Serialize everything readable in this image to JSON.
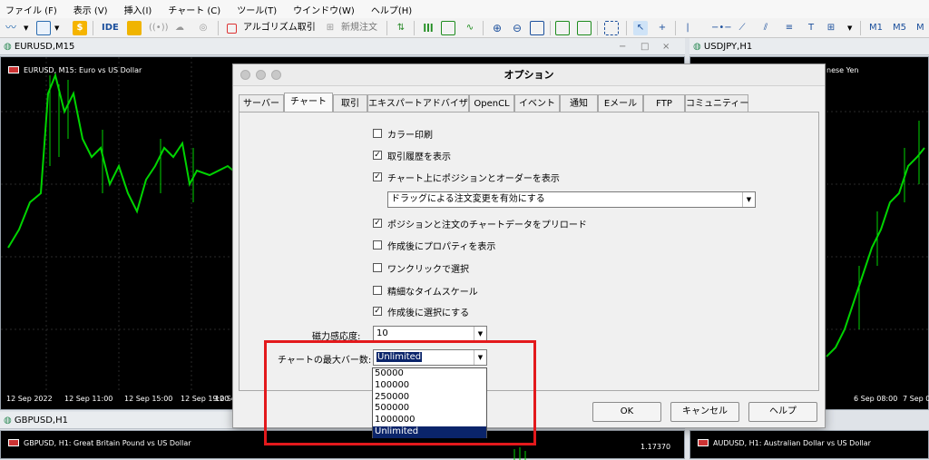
{
  "menu": [
    "ファイル (F)",
    "表示 (V)",
    "挿入(I)",
    "チャート (C)",
    "ツール(T)",
    "ウインドウ(W)",
    "ヘルプ(H)"
  ],
  "toolbar": {
    "ide_label": "IDE",
    "algo_label": "アルゴリズム取引",
    "new_order_label": "新規注文",
    "timeframes": [
      "M1",
      "M5",
      "M"
    ]
  },
  "windows": {
    "eurusd": {
      "title": "EURUSD,M15",
      "subtitle": "EURUSD, M15: Euro vs US Dollar",
      "time_labels": [
        "12 Sep 2022",
        "12 Sep 11:00",
        "12 Sep 15:00",
        "12 Sep 19:00",
        "12 Se"
      ]
    },
    "usdjpy": {
      "title": "USDJPY,H1",
      "subtitle": "nese Yen",
      "time_labels": [
        "6 Sep 08:00",
        "7 Sep 0"
      ]
    },
    "gbpusd": {
      "title": "GBPUSD,H1",
      "subtitle": "GBPUSD, H1: Great Britain Pound vs US Dollar",
      "price": "1.17370"
    },
    "audusd": {
      "subtitle": "AUDUSD, H1: Australian Dollar vs US Dollar"
    }
  },
  "dialog": {
    "title": "オプション",
    "tabs": [
      "サーバー",
      "チャート",
      "取引",
      "エキスパートアドバイザ",
      "OpenCL",
      "イベント",
      "通知",
      "Eメール",
      "FTP",
      "コミュニティー"
    ],
    "active_tab": "チャート",
    "options": [
      {
        "label": "カラー印刷",
        "checked": false
      },
      {
        "label": "取引履歴を表示",
        "checked": true
      },
      {
        "label": "チャート上にポジションとオーダーを表示",
        "checked": true
      }
    ],
    "drag_combo": "ドラッグによる注文変更を有効にする",
    "options2": [
      {
        "label": "ポジションと注文のチャートデータをプリロード",
        "checked": true
      },
      {
        "label": "作成後にプロパティを表示",
        "checked": false
      },
      {
        "label": "ワンクリックで選択",
        "checked": false
      },
      {
        "label": "精細なタイムスケール",
        "checked": false
      },
      {
        "label": "作成後に選択にする",
        "checked": true
      }
    ],
    "magnet_label": "磁力感応度:",
    "magnet_value": "10",
    "maxbars_label": "チャートの最大バー数:",
    "maxbars_value": "Unlimited",
    "maxbars_options": [
      "50000",
      "100000",
      "250000",
      "500000",
      "1000000",
      "Unlimited"
    ],
    "ok_label": "OK",
    "cancel_label": "キャンセル",
    "help_label": "ヘルプ"
  }
}
